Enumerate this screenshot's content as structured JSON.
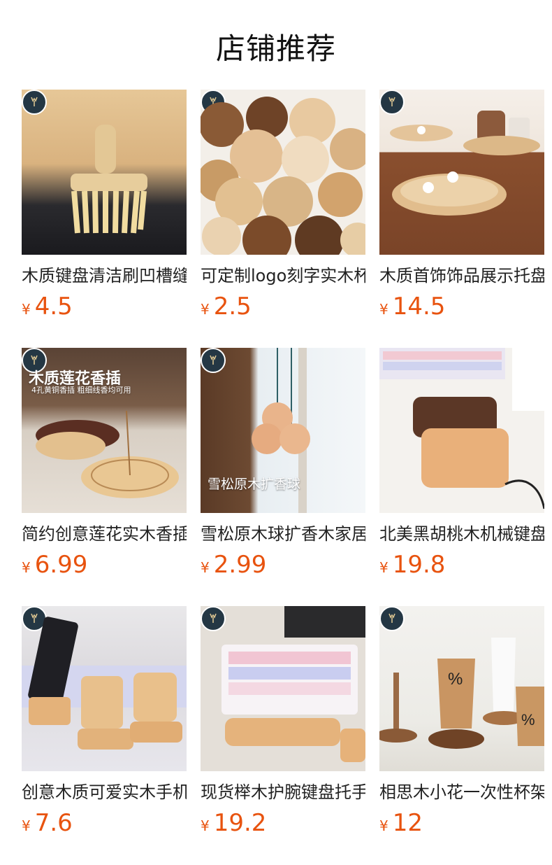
{
  "header": {
    "title": "店铺推荐"
  },
  "products": [
    {
      "name": "木质键盘清洁刷凹槽缝隙除尘刷",
      "currency": "¥",
      "price": "4.5",
      "image_label": "keyboard-brush-image"
    },
    {
      "name": "可定制logo刻字实木杯垫",
      "currency": "¥",
      "price": "2.5",
      "image_label": "wood-coasters-image"
    },
    {
      "name": "木质首饰饰品展示托盘",
      "currency": "¥",
      "price": "14.5",
      "image_label": "jewelry-tray-image"
    },
    {
      "name": "简约创意莲花实木香插",
      "currency": "¥",
      "price": "6.99",
      "image_label": "lotus-incense-holder-image",
      "overlay_title": "木质莲花香插",
      "overlay_sub": "4孔黄铜香插 粗细线香均可用"
    },
    {
      "name": "雪松原木球扩香木家居挂件",
      "currency": "¥",
      "price": "2.99",
      "image_label": "cedar-ball-diffuser-image",
      "overlay_caption": "雪松原木扩香球"
    },
    {
      "name": "北美黑胡桃木机械键盘手托",
      "currency": "¥",
      "price": "19.8",
      "image_label": "walnut-wrist-rest-image"
    },
    {
      "name": "创意木质可爱实木手机支架",
      "currency": "¥",
      "price": "7.6",
      "image_label": "phone-stand-image"
    },
    {
      "name": "现货榉木护腕键盘托手托",
      "currency": "¥",
      "price": "19.2",
      "image_label": "beech-wrist-rest-image"
    },
    {
      "name": "相思木小花一次性杯架",
      "currency": "¥",
      "price": "12",
      "image_label": "cup-holder-image"
    }
  ],
  "colors": {
    "price": "#e8530f",
    "badge": "#243744"
  }
}
